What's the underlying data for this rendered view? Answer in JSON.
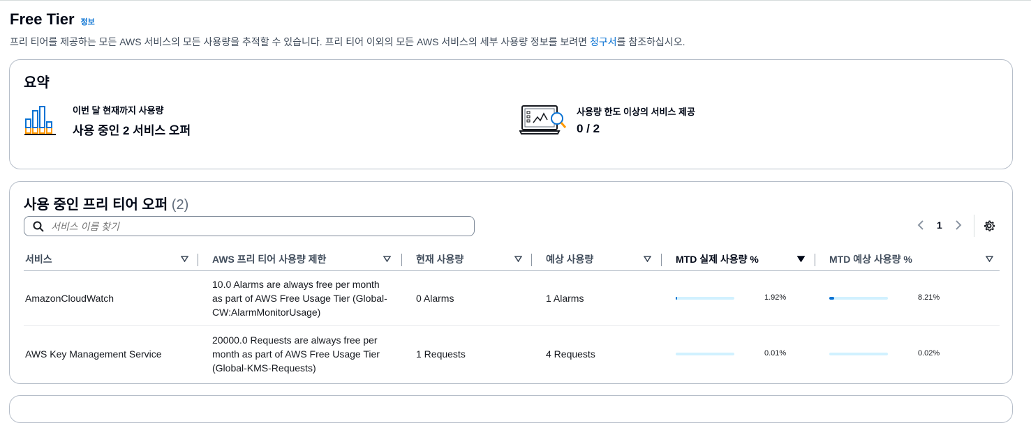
{
  "header": {
    "title": "Free Tier",
    "info_link": "정보",
    "description_before": "프리 티어를 제공하는 모든 AWS 서비스의 모든 사용량을 추적할 수 있습니다. 프리 티어 이외의 모든 AWS 서비스의 세부 사용량 정보를 보려면 ",
    "description_link": "청구서",
    "description_after": "를 참조하십시오."
  },
  "summary": {
    "title": "요약",
    "metric1": {
      "icon": "bar-chart-icon",
      "label": "이번 달 현재까지 사용량",
      "value": "사용 중인 2 서비스 오퍼"
    },
    "metric2": {
      "icon": "monitor-search-icon",
      "label": "사용량 한도 이상의 서비스 제공",
      "value": "0 / 2"
    }
  },
  "offers": {
    "title": "사용 중인 프리 티어 오퍼",
    "count": "(2)",
    "search_placeholder": "서비스 이름 찾기",
    "page": "1",
    "columns": [
      "서비스",
      "AWS 프리 티어 사용량 제한",
      "현재 사용량",
      "예상 사용량",
      "MTD 실제 사용량 %",
      "MTD 예상 사용량 %"
    ],
    "sorted_column": "MTD 실제 사용량 %",
    "rows": [
      {
        "service": "AmazonCloudWatch",
        "limit_lines": [
          "10.0 Alarms are always free per month",
          "as part of AWS Free Usage Tier (Global-",
          "CW:AlarmMonitorUsage)"
        ],
        "current": "0 Alarms",
        "forecast": "1 Alarms",
        "mtd_actual": "1.92%",
        "mtd_actual_value": 1.92,
        "mtd_forecast": "8.21%",
        "mtd_forecast_value": 8.21
      },
      {
        "service": "AWS Key Management Service",
        "limit_lines": [
          "20000.0 Requests are always free per",
          "month as part of AWS Free Usage Tier",
          "(Global-KMS-Requests)"
        ],
        "current": "1 Requests",
        "forecast": "4 Requests",
        "mtd_actual": "0.01%",
        "mtd_actual_value": 0.01,
        "mtd_forecast": "0.02%",
        "mtd_forecast_value": 0.02
      }
    ]
  },
  "colors": {
    "link": "#0972d3",
    "progress": "#0972d3",
    "progress_track": "#d1f1ff"
  }
}
